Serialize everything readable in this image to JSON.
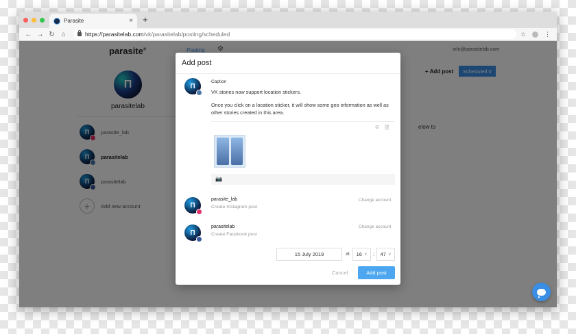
{
  "browser": {
    "tab_title": "Parasite",
    "tab_close": "×",
    "new_tab": "+",
    "url_host": "https://parasitelab.com",
    "url_path": "/vk/parasitelab/posting/scheduled",
    "nav": {
      "back": "←",
      "forward": "→",
      "reload": "↻",
      "home": "⌂"
    },
    "star": "☆",
    "menu": "⋮"
  },
  "app": {
    "logo": "parasite",
    "logo_mark": "®",
    "nav_posting": "Posting",
    "nav_gear": "⚙",
    "user_email": "info@parasitelab.com",
    "add_post_link": "+ Add post",
    "scheduled_btn": "Scheduled 0",
    "profile_name": "parasitelab",
    "profile_glyph": "Π",
    "accounts": [
      {
        "label": "parasite_lab",
        "glyph": "Π",
        "network": "instagram",
        "badge_color": "#e1306c"
      },
      {
        "label": "parasitelab",
        "glyph": "Π",
        "network": "vk",
        "badge_color": "#4a76a8"
      },
      {
        "label": "parasitelab",
        "glyph": "Π",
        "network": "facebook",
        "badge_color": "#3b5998"
      }
    ],
    "add_account": "Add new account",
    "add_account_glyph": "+",
    "below_text": "elow to"
  },
  "modal": {
    "title": "Add post",
    "caption_label": "Caption",
    "glyph": "Π",
    "vk_badge_color": "#4a76a8",
    "caption_paragraphs": [
      "VK stories now support location stickers.",
      "Once you click on a location sticker, it will show some geo information as well as other stories created in this area."
    ],
    "emoji_icon": "☺",
    "doc_icon": "🗎",
    "camera_icon": "📷",
    "accounts": [
      {
        "name": "parasite_lab",
        "sub": "Create Instagram post",
        "change": "Change account",
        "badge_color": "#e1306c"
      },
      {
        "name": "parasitelab",
        "sub": "Create Facebook post",
        "change": "Change account",
        "badge_color": "#3b5998"
      }
    ],
    "date": "15 July 2019",
    "at_label": "at",
    "hour": "16",
    "minute": "47",
    "colon": ":",
    "chevron": "∨",
    "cancel": "Cancel",
    "submit": "Add post"
  }
}
